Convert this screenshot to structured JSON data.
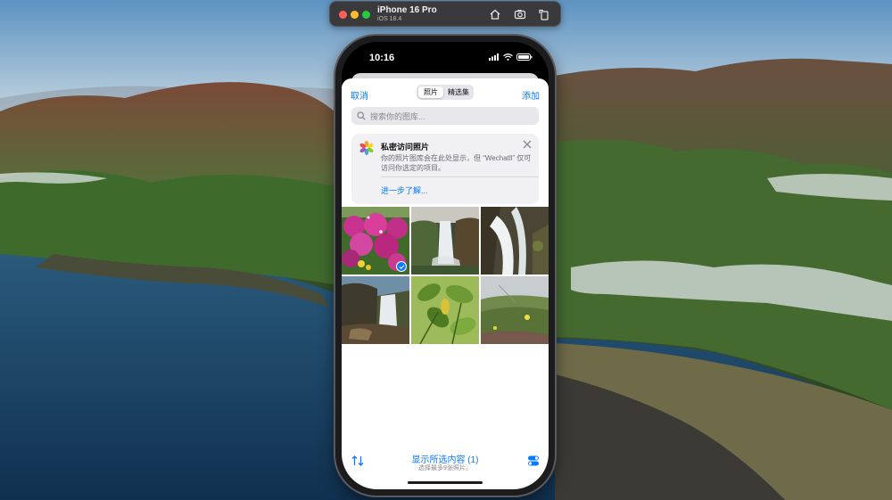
{
  "simulator": {
    "device": "iPhone 16 Pro",
    "os": "iOS 18.4"
  },
  "status_bar": {
    "time": "10:16"
  },
  "picker": {
    "cancel": "取消",
    "add": "添加",
    "tabs": [
      "照片",
      "精选集"
    ],
    "selected_tab": "照片",
    "search_placeholder": "搜索你的图库..."
  },
  "privacy_notice": {
    "title": "私密访问照片",
    "body": "你的照片图库会在此处显示，但 “Wechatll” 仅可访问你选定的项目。",
    "link": "进一步了解..."
  },
  "photos": [
    {
      "subject": "pink flowers",
      "selected": true
    },
    {
      "subject": "waterfall",
      "selected": false
    },
    {
      "subject": "waterfall closeup",
      "selected": false
    },
    {
      "subject": "waterfall rocks",
      "selected": false
    },
    {
      "subject": "green leaves",
      "selected": false
    },
    {
      "subject": "hillside flowers",
      "selected": false
    }
  ],
  "footer": {
    "title": "显示所选内容 (1)",
    "subtitle": "选择最多9张照片。"
  },
  "colors": {
    "accent": "#0a7aff"
  }
}
